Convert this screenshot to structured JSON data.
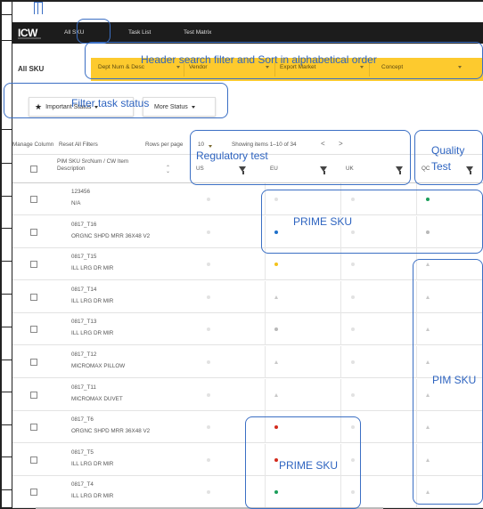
{
  "nav": {
    "logo": "ICW",
    "items": [
      "All SKU",
      "Task List",
      "Test Matrix"
    ]
  },
  "page": {
    "title": "All SKU"
  },
  "header_filters": [
    "Dept Num & Desc",
    "Vendor",
    "Export Market",
    "Concept"
  ],
  "status_buttons": {
    "important": "Important Status",
    "more": "More Status"
  },
  "toolbar": {
    "manage_column": "Manage Column",
    "reset_filters": "Reset All Filters",
    "rows_per_page_label": "Rows per page",
    "rows_per_page_value": "10",
    "showing": "Showing items 1–10 of 34",
    "prev": "<",
    "next": ">"
  },
  "table": {
    "columns": {
      "sku": "PIM SKU SrcNum / CW Item Description",
      "us": "US",
      "eu": "EU",
      "uk": "UK",
      "qc": "QC"
    },
    "rows": [
      {
        "num": "123456",
        "desc": "N/A",
        "us": "dot-light",
        "eu": "dot-light",
        "uk": "dot-light",
        "qc": "dot-green"
      },
      {
        "num": "0817_T16",
        "desc": "ORGNC SHPD MRR 36X48 V2",
        "us": "dot-light",
        "eu": "dot-blue",
        "uk": "dot-light",
        "qc": "dot-gray"
      },
      {
        "num": "0817_T15",
        "desc": "ILL LRG DR MIR",
        "us": "dot-light",
        "eu": "dot-yellow",
        "uk": "dot-light",
        "qc": "tri"
      },
      {
        "num": "0817_T14",
        "desc": "ILL LRG DR MIR",
        "us": "dot-light",
        "eu": "tri",
        "uk": "dot-light",
        "qc": "tri"
      },
      {
        "num": "0817_T13",
        "desc": "ILL LRG DR MIR",
        "us": "dot-light",
        "eu": "dot-gray",
        "uk": "dot-light",
        "qc": "tri"
      },
      {
        "num": "0817_T12",
        "desc": "MICROMAX PILLOW",
        "us": "dot-light",
        "eu": "tri",
        "uk": "dot-light",
        "qc": "tri"
      },
      {
        "num": "0817_T11",
        "desc": "MICROMAX DUVET",
        "us": "dot-light",
        "eu": "tri",
        "uk": "dot-light",
        "qc": "tri"
      },
      {
        "num": "0817_T6",
        "desc": "ORGNC SHPD MRR 36X48 V2",
        "us": "dot-light",
        "eu": "dot-red",
        "uk": "dot-light",
        "qc": "tri"
      },
      {
        "num": "0817_T5",
        "desc": "ILL LRG DR MIR",
        "us": "dot-light",
        "eu": "dot-red",
        "uk": "dot-light",
        "qc": "tri"
      },
      {
        "num": "0817_T4",
        "desc": "ILL LRG DR MIR",
        "us": "dot-light",
        "eu": "dot-green",
        "uk": "dot-light",
        "qc": "tri"
      }
    ]
  },
  "colors": {
    "nav_bg": "#1c1c1c",
    "header_bar": "#fdca2e",
    "annotation": "#3b6fc4",
    "dot-light": "#e2e2e2",
    "dot-gray": "#b8b8b8",
    "dot-green": "#1a9e5a",
    "dot-blue": "#1d6fc9",
    "dot-yellow": "#f4c21b",
    "dot-red": "#d32b1d"
  },
  "annotations": {
    "header_search": "Header search filter and Sort in alphabetical order",
    "filter_task_status": "Filter task status",
    "regulatory_test": "Regulatory test",
    "quality_test": "Quality Test",
    "prime_sku_1": "PRIME SKU",
    "prime_sku_2": "PRIME SKU",
    "pim_sku": "PIM SKU"
  }
}
